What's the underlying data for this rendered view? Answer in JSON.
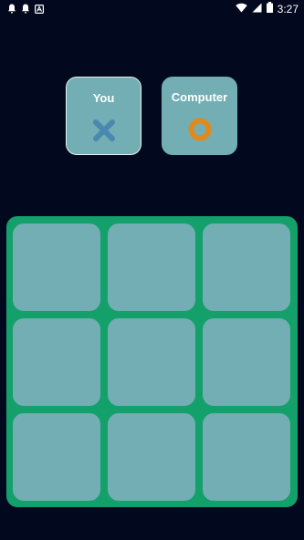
{
  "status_bar": {
    "time": "3:27",
    "icons": [
      "notification-icon",
      "notification-icon",
      "app-icon",
      "wifi-icon",
      "signal-icon",
      "battery-icon"
    ]
  },
  "players": {
    "you": {
      "label": "You",
      "mark": "X",
      "active": true
    },
    "computer": {
      "label": "Computer",
      "mark": "O",
      "active": false
    }
  },
  "board": {
    "cells": [
      "",
      "",
      "",
      "",
      "",
      "",
      "",
      "",
      ""
    ]
  },
  "colors": {
    "background": "#02091f",
    "card": "#72aeb3",
    "board": "#14a06a",
    "x_mark": "#4b88b0",
    "o_mark": "#e08a1e",
    "active_border": "#e8f2f3"
  }
}
